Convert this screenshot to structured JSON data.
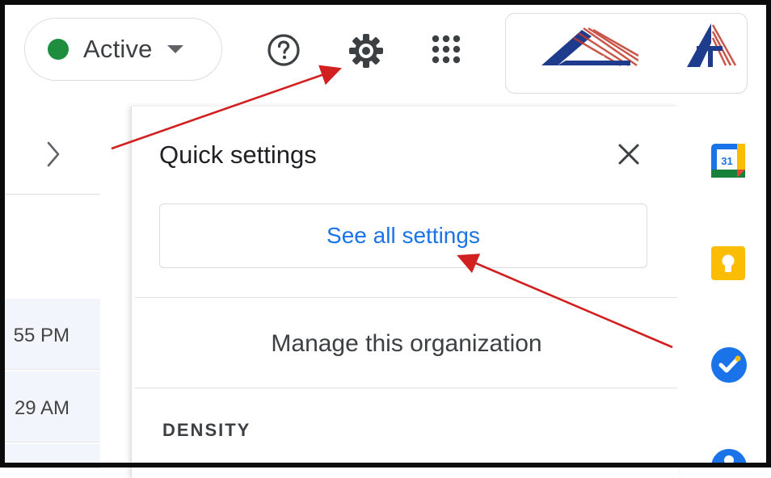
{
  "top_bar": {
    "status": {
      "label": "Active",
      "dot_color": "#1e8e3e"
    },
    "icons": [
      "help-icon",
      "settings-gear-icon",
      "google-apps-icon"
    ],
    "org_logos": [
      "org-logo-a",
      "org-logo-b"
    ]
  },
  "mail_list": {
    "rows": [
      {
        "time": "55 PM"
      },
      {
        "time": "29 AM"
      }
    ]
  },
  "quick_settings": {
    "title": "Quick settings",
    "see_all_label": "See all settings",
    "manage_org_label": "Manage this organization",
    "density_label": "DENSITY",
    "accent_color": "#1a73e8"
  },
  "side_rail": {
    "apps": [
      "calendar-icon",
      "keep-icon",
      "tasks-icon",
      "contacts-icon"
    ],
    "calendar_day": "31"
  },
  "annotations": {
    "arrow_color": "#d21f1f"
  }
}
